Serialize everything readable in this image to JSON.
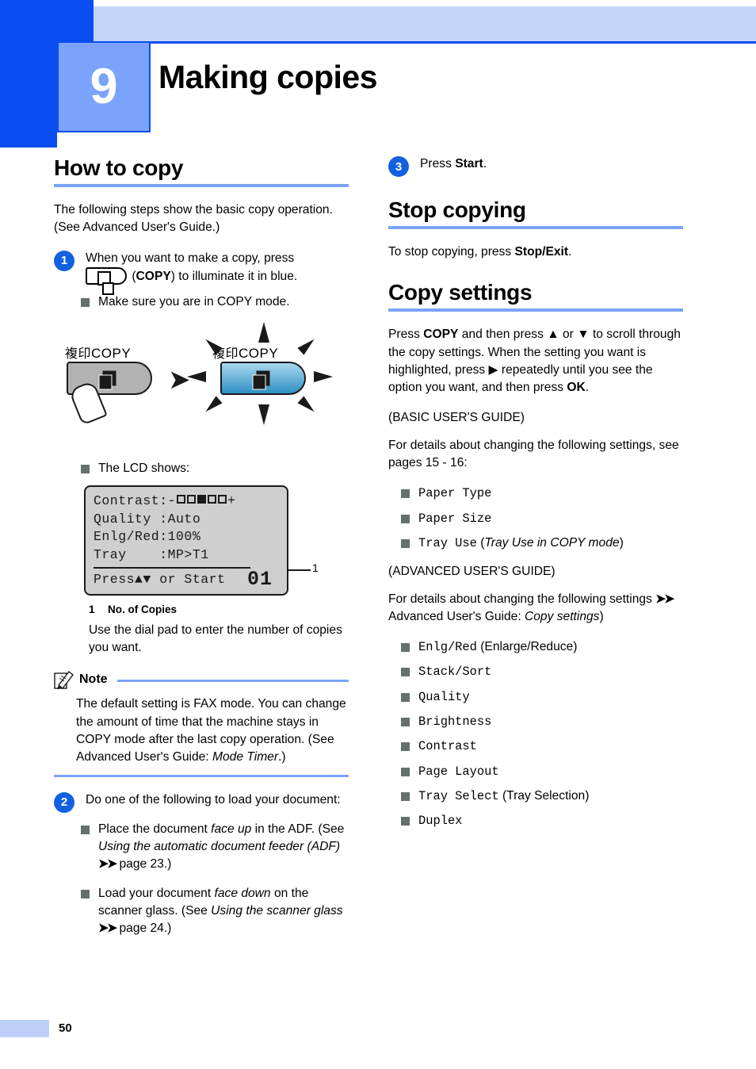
{
  "chapter": {
    "number": "9",
    "title": "Making copies"
  },
  "colors": {
    "accent_dark": "#0a4df0",
    "accent_mid": "#7ba3fb",
    "accent_light": "#c3d6f9",
    "badge": "#1161e0"
  },
  "left": {
    "heading": "How to copy",
    "intro": "The following steps show the basic copy operation. (See Advanced User's Guide.)",
    "step1": {
      "badge": "1",
      "text_before": "When you want to make a copy, press",
      "key_label": "COPY",
      "text_after": ") to illuminate it in blue.",
      "bullet": "Make sure you are in COPY mode."
    },
    "figure": {
      "left_label_cjk": "複印",
      "left_label_latin": "COPY",
      "right_label_cjk": "複印",
      "right_label_latin": "COPY"
    },
    "lcd_intro": "The LCD shows:",
    "lcd": {
      "line1_label": "Contrast:",
      "line1_minus": "-",
      "line1_plus": "+",
      "line1_boxes": [
        false,
        false,
        true,
        false,
        false
      ],
      "line2": "Quality :Auto",
      "line3": "Enlg/Red:100%",
      "line4": "Tray    :MP>T1",
      "line5": "Press▲▼ or Start",
      "count": "01",
      "callout": "1"
    },
    "caption": {
      "num": "1",
      "text": "No. of Copies"
    },
    "caption_body": "Use the dial pad to enter the number of copies you want.",
    "note": {
      "title": "Note",
      "body_1": "The default setting is FAX mode. You can change the amount of time that the machine stays in COPY mode after the last copy operation. (See Advanced User's Guide: ",
      "body_italic": "Mode Timer",
      "body_2": ".)"
    },
    "step2": {
      "badge": "2",
      "text": "Do one of the following to load your document:",
      "bullets": [
        {
          "a": "Place the document ",
          "i1": "face up",
          "b": " in the ADF. (See ",
          "i2": "Using the automatic document feeder (ADF)",
          "arrow": "➤➤",
          "c": " page 23.)"
        },
        {
          "a": "Load your document ",
          "i1": "face down",
          "b": " on the scanner glass. (See ",
          "i2": "Using the scanner glass",
          "arrow": "➤➤",
          "c": " page 24.)"
        }
      ]
    }
  },
  "right": {
    "step3": {
      "badge": "3",
      "text_before": "Press ",
      "bold": "Start",
      "text_after": "."
    },
    "stop_heading": "Stop copying",
    "stop_body_before": "To stop copying, press ",
    "stop_body_bold": "Stop/Exit",
    "stop_body_after": ".",
    "copy_heading": "Copy settings",
    "copy_body": {
      "p1_a": "Press ",
      "p1_bold1": "COPY",
      "p1_b": " and then press ▲ or ▼ to scroll through the copy settings. When the setting you want is highlighted, press ▶ repeatedly until you see the option you want, and then press ",
      "p1_bold2": "OK",
      "p1_c": "."
    },
    "basic_guide_label": "(BASIC USER'S GUIDE)",
    "basic_intro": "For details about changing the following settings, see pages 15 - 16:",
    "basic_items": [
      {
        "mono": "Paper Type",
        "plain": ""
      },
      {
        "mono": "Paper Size",
        "plain": ""
      },
      {
        "mono": "Tray Use",
        "plain": " (",
        "italic": "Tray Use in COPY mode",
        "plain2": ")"
      }
    ],
    "advanced_guide_label": "(ADVANCED USER'S GUIDE)",
    "advanced_intro_a": "For details about changing the following settings ",
    "advanced_intro_arrow": "➤➤",
    "advanced_intro_b": " Advanced User's Guide: ",
    "advanced_intro_italic": "Copy settings",
    "advanced_intro_c": ")",
    "advanced_items": [
      {
        "mono": "Enlg/Red",
        "plain": " (Enlarge/Reduce)"
      },
      {
        "mono": "Stack/Sort",
        "plain": ""
      },
      {
        "mono": "Quality",
        "plain": ""
      },
      {
        "mono": "Brightness",
        "plain": ""
      },
      {
        "mono": "Contrast",
        "plain": ""
      },
      {
        "mono": "Page Layout",
        "plain": ""
      },
      {
        "mono": "Tray Select",
        "plain": " (Tray Selection)"
      },
      {
        "mono": "Duplex",
        "plain": ""
      }
    ]
  },
  "footer": {
    "page_number": "50"
  }
}
